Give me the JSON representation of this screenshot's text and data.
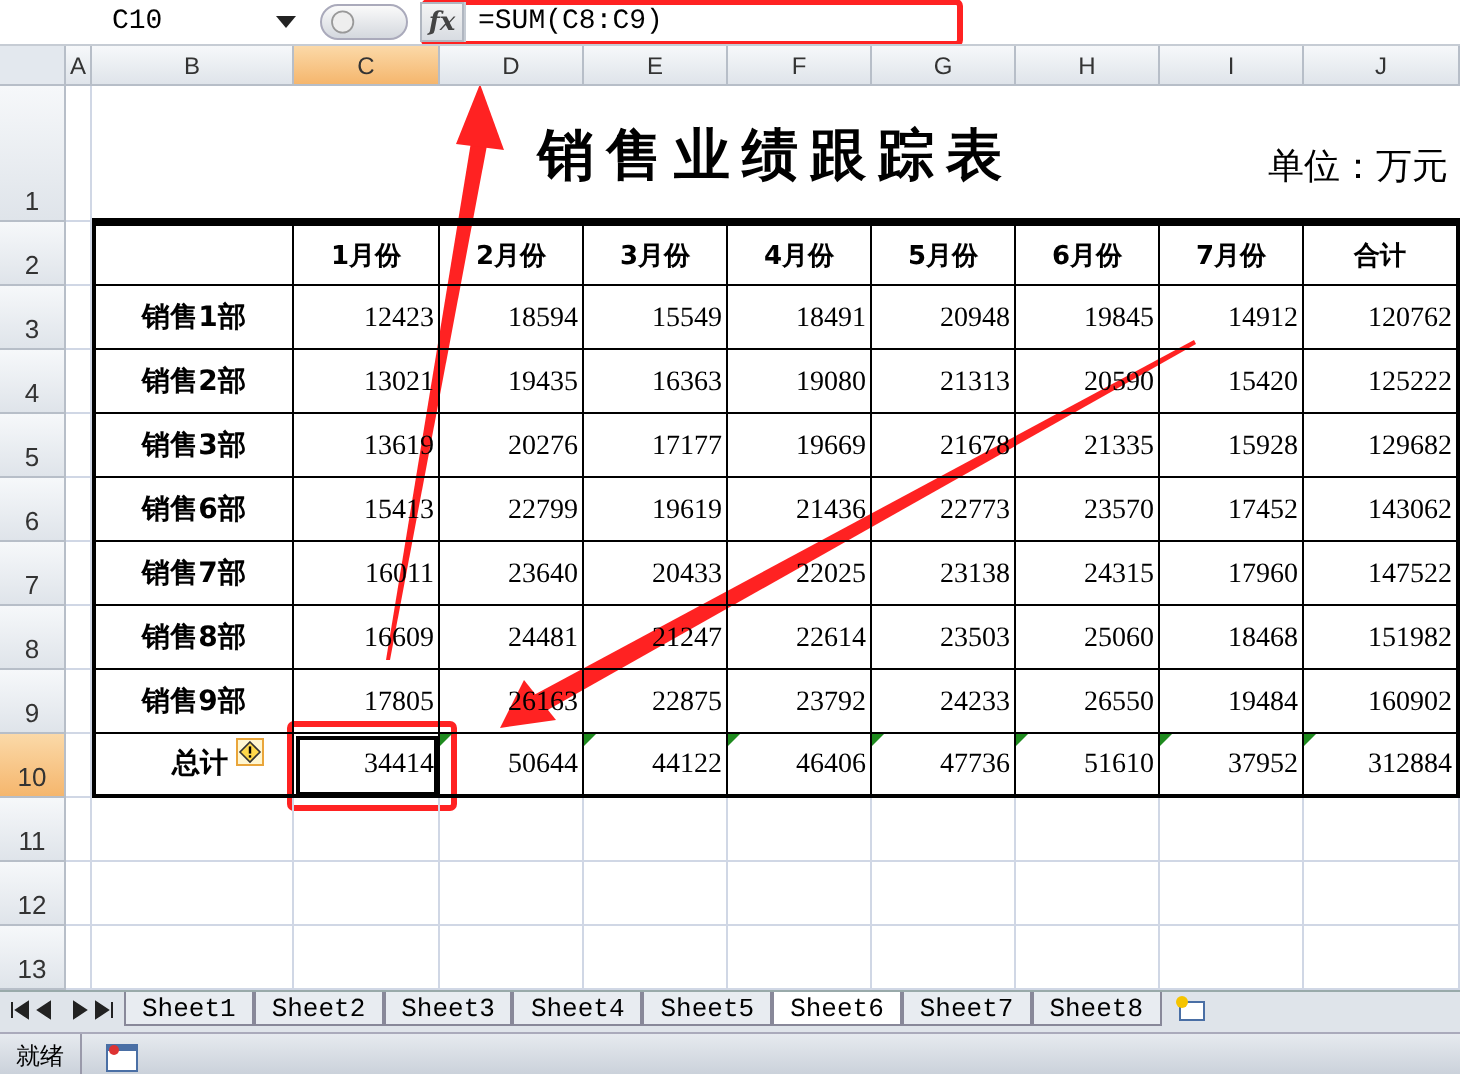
{
  "formula_bar": {
    "name_box": "C10",
    "function_button": "fx",
    "formula": "=SUM(C8:C9)"
  },
  "columns": [
    {
      "label": "A",
      "selected": false
    },
    {
      "label": "B",
      "selected": false
    },
    {
      "label": "C",
      "selected": true
    },
    {
      "label": "D",
      "selected": false
    },
    {
      "label": "E",
      "selected": false
    },
    {
      "label": "F",
      "selected": false
    },
    {
      "label": "G",
      "selected": false
    },
    {
      "label": "H",
      "selected": false
    },
    {
      "label": "I",
      "selected": false
    },
    {
      "label": "J",
      "selected": false
    }
  ],
  "row_numbers": [
    {
      "label": "1",
      "selected": false
    },
    {
      "label": "2",
      "selected": false
    },
    {
      "label": "3",
      "selected": false
    },
    {
      "label": "4",
      "selected": false
    },
    {
      "label": "5",
      "selected": false
    },
    {
      "label": "6",
      "selected": false
    },
    {
      "label": "7",
      "selected": false
    },
    {
      "label": "8",
      "selected": false
    },
    {
      "label": "9",
      "selected": false
    },
    {
      "label": "10",
      "selected": true
    },
    {
      "label": "11",
      "selected": false
    },
    {
      "label": "12",
      "selected": false
    },
    {
      "label": "13",
      "selected": false
    }
  ],
  "sheet": {
    "title": "销售业绩跟踪表",
    "unit": "单位：万元",
    "table": {
      "columns": [
        "1月份",
        "2月份",
        "3月份",
        "4月份",
        "5月份",
        "6月份",
        "7月份",
        "合计"
      ],
      "rows": [
        {
          "kind": "data",
          "label": "销售1部",
          "cells": [
            "12423",
            "18594",
            "15549",
            "18491",
            "20948",
            "19845",
            "14912",
            "120762"
          ]
        },
        {
          "kind": "data",
          "label": "销售2部",
          "cells": [
            "13021",
            "19435",
            "16363",
            "19080",
            "21313",
            "20590",
            "15420",
            "125222"
          ]
        },
        {
          "kind": "data",
          "label": "销售3部",
          "cells": [
            "13619",
            "20276",
            "17177",
            "19669",
            "21678",
            "21335",
            "15928",
            "129682"
          ]
        },
        {
          "kind": "data",
          "label": "销售6部",
          "cells": [
            "15413",
            "22799",
            "19619",
            "21436",
            "22773",
            "23570",
            "17452",
            "143062"
          ]
        },
        {
          "kind": "data",
          "label": "销售7部",
          "cells": [
            "16011",
            "23640",
            "20433",
            "22025",
            "23138",
            "24315",
            "17960",
            "147522"
          ]
        },
        {
          "kind": "data",
          "label": "销售8部",
          "cells": [
            "16609",
            "24481",
            "21247",
            "22614",
            "23503",
            "25060",
            "18468",
            "151982"
          ]
        },
        {
          "kind": "data",
          "label": "销售9部",
          "cells": [
            "17805",
            "26163",
            "22875",
            "23792",
            "24233",
            "26550",
            "19484",
            "160902"
          ]
        },
        {
          "kind": "total",
          "label": "总计",
          "cells": [
            "34414",
            "50644",
            "44122",
            "46406",
            "47736",
            "51610",
            "37952",
            "312884"
          ],
          "error_flags": [
            false,
            true,
            true,
            true,
            true,
            true,
            true,
            true
          ]
        }
      ]
    }
  },
  "sheet_tabs": [
    {
      "label": "Sheet1",
      "selected": false
    },
    {
      "label": "Sheet2",
      "selected": false
    },
    {
      "label": "Sheet3",
      "selected": false
    },
    {
      "label": "Sheet4",
      "selected": false
    },
    {
      "label": "Sheet5",
      "selected": false
    },
    {
      "label": "Sheet6",
      "selected": true
    },
    {
      "label": "Sheet7",
      "selected": false
    },
    {
      "label": "Sheet8",
      "selected": false
    }
  ],
  "status_bar": {
    "text": "就绪"
  }
}
